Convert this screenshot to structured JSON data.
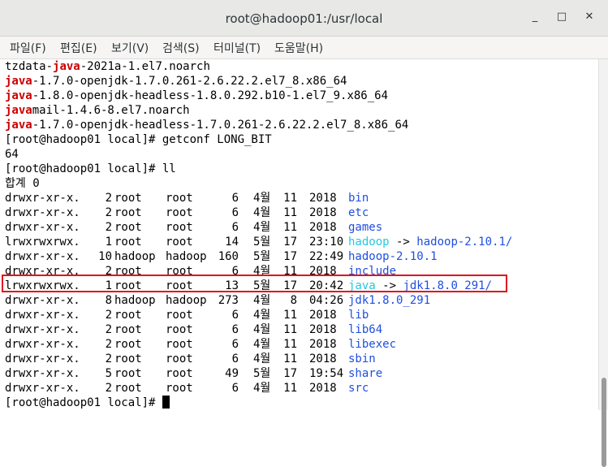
{
  "window": {
    "title": "root@hadoop01:/usr/local",
    "minimize_glyph": "_",
    "maximize_glyph": "□",
    "close_glyph": "✕"
  },
  "menu": [
    "파일(F)",
    "편집(E)",
    "보기(V)",
    "검색(S)",
    "터미널(T)",
    "도움말(H)"
  ],
  "terminal": {
    "rpm_lines": [
      {
        "pre": "tzdata-",
        "hl": "java",
        "post": "-2021a-1.el7.noarch"
      },
      {
        "pre": "",
        "hl": "java",
        "post": "-1.7.0-openjdk-1.7.0.261-2.6.22.2.el7_8.x86_64"
      },
      {
        "pre": "",
        "hl": "java",
        "post": "-1.8.0-openjdk-headless-1.8.0.292.b10-1.el7_9.x86_64"
      },
      {
        "pre": "",
        "hl": "java",
        "post": "mail-1.4.6-8.el7.noarch"
      },
      {
        "pre": "",
        "hl": "java",
        "post": "-1.7.0-openjdk-headless-1.7.0.261-2.6.22.2.el7_8.x86_64"
      }
    ],
    "cmd1": "[root@hadoop01 local]# getconf LONG_BIT",
    "cmd1_output": "64",
    "cmd2": "[root@hadoop01 local]# ll",
    "total": "합계 0",
    "ls_rows": [
      {
        "perm": "drwxr-xr-x.",
        "links": "2",
        "owner": "root",
        "group": "root",
        "size": "6",
        "month": "4월",
        "day": "11",
        "time": "2018",
        "name": "bin",
        "name_color": "blue",
        "arrow": "",
        "target": ""
      },
      {
        "perm": "drwxr-xr-x.",
        "links": "2",
        "owner": "root",
        "group": "root",
        "size": "6",
        "month": "4월",
        "day": "11",
        "time": "2018",
        "name": "etc",
        "name_color": "blue",
        "arrow": "",
        "target": ""
      },
      {
        "perm": "drwxr-xr-x.",
        "links": "2",
        "owner": "root",
        "group": "root",
        "size": "6",
        "month": "4월",
        "day": "11",
        "time": "2018",
        "name": "games",
        "name_color": "blue",
        "arrow": "",
        "target": ""
      },
      {
        "perm": "lrwxrwxrwx.",
        "links": "1",
        "owner": "root",
        "group": "root",
        "size": "14",
        "month": "5월",
        "day": "17",
        "time": "23:10",
        "name": "hadoop",
        "name_color": "cyan",
        "arrow": "->",
        "target": "hadoop-2.10.1/"
      },
      {
        "perm": "drwxr-xr-x.",
        "links": "10",
        "owner": "hadoop",
        "group": "hadoop",
        "size": "160",
        "month": "5월",
        "day": "17",
        "time": "22:49",
        "name": "hadoop-2.10.1",
        "name_color": "blue",
        "arrow": "",
        "target": ""
      },
      {
        "perm": "drwxr-xr-x.",
        "links": "2",
        "owner": "root",
        "group": "root",
        "size": "6",
        "month": "4월",
        "day": "11",
        "time": "2018",
        "name": "include",
        "name_color": "blue",
        "arrow": "",
        "target": ""
      },
      {
        "perm": "lrwxrwxrwx.",
        "links": "1",
        "owner": "root",
        "group": "root",
        "size": "13",
        "month": "5월",
        "day": "17",
        "time": "20:42",
        "name": "java",
        "name_color": "cyan",
        "arrow": "->",
        "target": "jdk1.8.0_291/"
      },
      {
        "perm": "drwxr-xr-x.",
        "links": "8",
        "owner": "hadoop",
        "group": "hadoop",
        "size": "273",
        "month": "4월",
        "day": "8",
        "time": "04:26",
        "name": "jdk1.8.0_291",
        "name_color": "blue",
        "arrow": "",
        "target": ""
      },
      {
        "perm": "drwxr-xr-x.",
        "links": "2",
        "owner": "root",
        "group": "root",
        "size": "6",
        "month": "4월",
        "day": "11",
        "time": "2018",
        "name": "lib",
        "name_color": "blue",
        "arrow": "",
        "target": ""
      },
      {
        "perm": "drwxr-xr-x.",
        "links": "2",
        "owner": "root",
        "group": "root",
        "size": "6",
        "month": "4월",
        "day": "11",
        "time": "2018",
        "name": "lib64",
        "name_color": "blue",
        "arrow": "",
        "target": ""
      },
      {
        "perm": "drwxr-xr-x.",
        "links": "2",
        "owner": "root",
        "group": "root",
        "size": "6",
        "month": "4월",
        "day": "11",
        "time": "2018",
        "name": "libexec",
        "name_color": "blue",
        "arrow": "",
        "target": ""
      },
      {
        "perm": "drwxr-xr-x.",
        "links": "2",
        "owner": "root",
        "group": "root",
        "size": "6",
        "month": "4월",
        "day": "11",
        "time": "2018",
        "name": "sbin",
        "name_color": "blue",
        "arrow": "",
        "target": ""
      },
      {
        "perm": "drwxr-xr-x.",
        "links": "5",
        "owner": "root",
        "group": "root",
        "size": "49",
        "month": "5월",
        "day": "17",
        "time": "19:54",
        "name": "share",
        "name_color": "blue",
        "arrow": "",
        "target": ""
      },
      {
        "perm": "drwxr-xr-x.",
        "links": "2",
        "owner": "root",
        "group": "root",
        "size": "6",
        "month": "4월",
        "day": "11",
        "time": "2018",
        "name": "src",
        "name_color": "blue",
        "arrow": "",
        "target": ""
      }
    ],
    "prompt": "[root@hadoop01 local]# ",
    "highlighted_entry": "java"
  },
  "colors": {
    "grep_match": "#cc0000",
    "directory": "#1f4fe0",
    "symlink": "#22c9e0",
    "highlight_box": "#e0141e"
  }
}
